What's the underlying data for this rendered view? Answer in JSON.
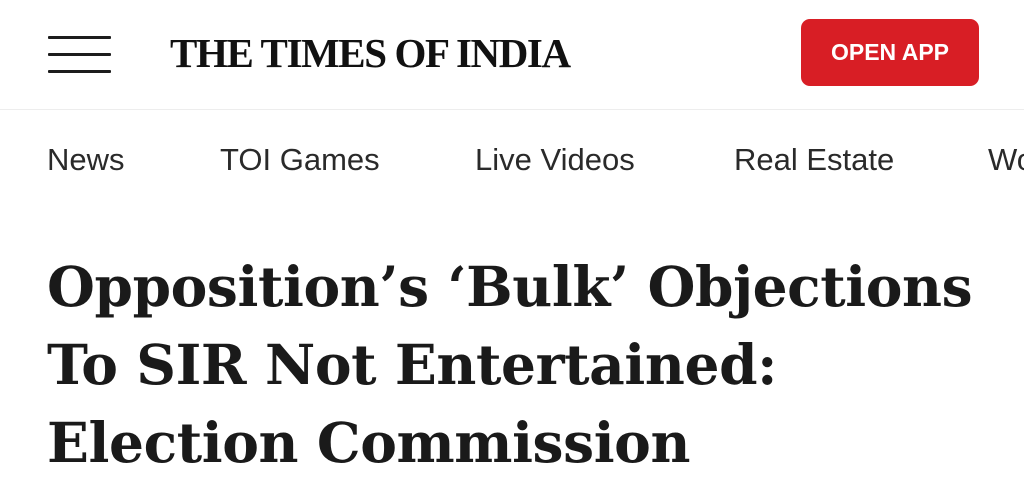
{
  "header": {
    "logo_text": "THE TIMES OF INDIA",
    "open_app_label": "OPEN APP",
    "menu_icon": "hamburger-menu-icon"
  },
  "nav": {
    "items": [
      {
        "label": "News"
      },
      {
        "label": "TOI Games"
      },
      {
        "label": "Live Videos"
      },
      {
        "label": "Real Estate"
      },
      {
        "label": "Wo"
      }
    ]
  },
  "article": {
    "headline": "Opposition’s ‘Bulk’ Objections To SIR Not Entertained: Election Commission"
  },
  "colors": {
    "accent": "#d81e25",
    "text": "#1c1c1c",
    "background": "#ffffff"
  }
}
